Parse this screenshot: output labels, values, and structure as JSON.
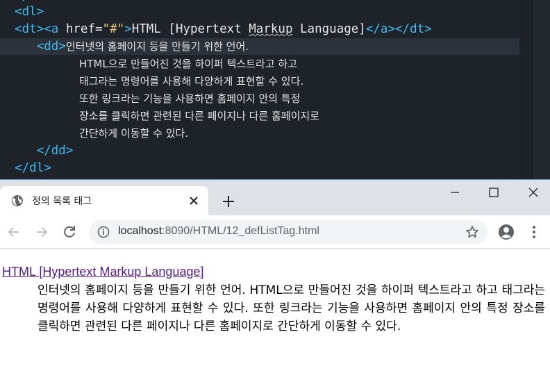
{
  "editor": {
    "line_0": "<dl>",
    "line_1": {
      "open_dt": "<dt>",
      "open_a": "<a ",
      "attr": "href=",
      "value": "\"#\"",
      "close_open": ">",
      "text_pre": "HTML [Hypertext ",
      "text_squiggle": "Markup",
      "text_post": " Language]",
      "close_a": "</a>",
      "close_dt": "</dt>"
    },
    "line_2": {
      "open_dd": "<dd>",
      "text": "인터넷의 홈페이지 등을 만들기 위한 언어."
    },
    "line_3": "HTML으로 만들어진 것을 하이퍼 텍스트라고 하고",
    "line_4": "태그라는 명령어를 사용해 다양하게 표현할 수 있다.",
    "line_5": "또한 링크라는 기능을 사용하면 홈페이지 안의 특정",
    "line_6": "장소를 클릭하면 관련된 다른 페이지나 다른 홈페이지로",
    "line_7": "간단하게 이동할 수 있다.",
    "line_8": "</dd>",
    "line_9": "</dl>"
  },
  "browser": {
    "tab_title": "정의 목록 태그",
    "url_host": "localhost",
    "url_path": ":8090/HTML/12_defListTag.html"
  },
  "content": {
    "term": "HTML [Hypertext Markup Language]",
    "definition": "인터넷의 홈페이지 등을 만들기 위한 언어. HTML으로 만들어진 것을 하이퍼 텍스트라고 하고 태그라는 명령어를 사용해 다양하게 표현할 수 있다. 또한 링크라는 기능을 사용하면 홈페이지 안의 특정 장소를 클릭하면 관련된 다른 페이지나 다른 홈페이지로 간단하게 이동할 수 있다."
  },
  "icons": {
    "tab_favicon": "globe-icon",
    "tab_close": "close-icon",
    "new_tab": "plus-icon",
    "minimize": "minimize-icon",
    "maximize": "maximize-icon",
    "close_window": "close-icon",
    "back": "arrow-left-icon",
    "forward": "arrow-right-icon",
    "reload": "reload-icon",
    "site_info": "info-icon",
    "bookmark": "star-icon",
    "profile": "account-icon",
    "menu": "kebab-menu-icon"
  },
  "colors": {
    "editor_bg": "#1e2329",
    "tag": "#40b8f0",
    "string": "#e5c07b",
    "visited_link": "#551a8b"
  }
}
